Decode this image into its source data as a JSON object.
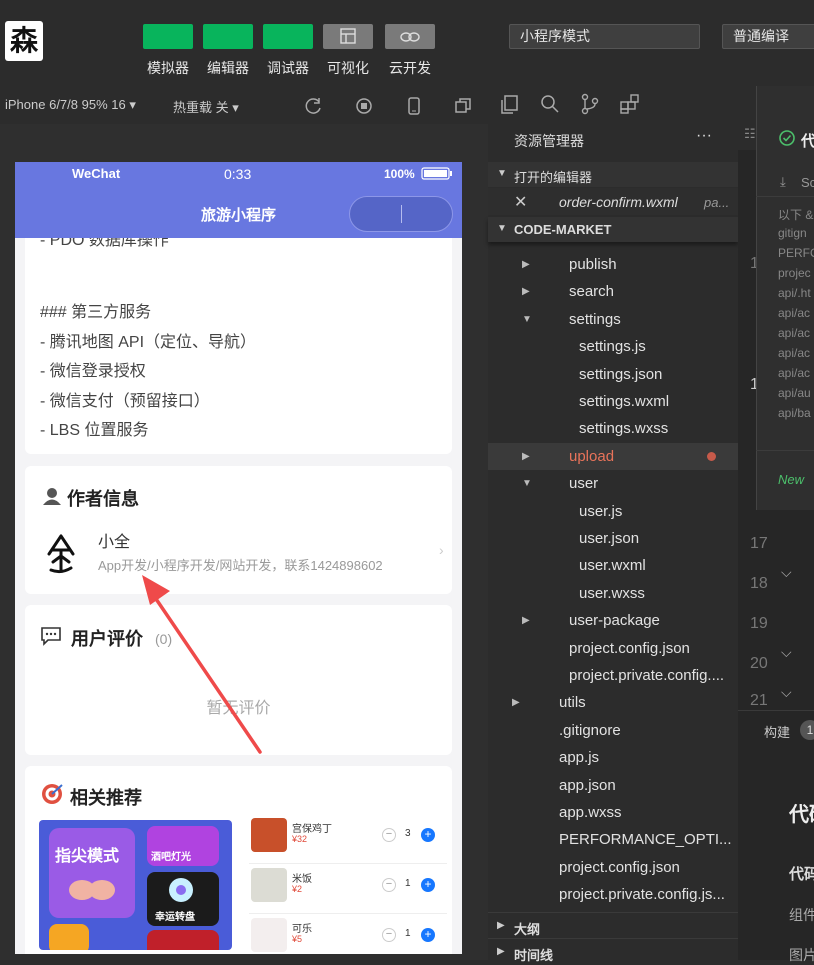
{
  "toolbar": {
    "logo": "森",
    "buttons": [
      {
        "label": "模拟器"
      },
      {
        "label": "编辑器"
      },
      {
        "label": "调试器"
      },
      {
        "label": "可视化"
      },
      {
        "label": "云开发"
      }
    ],
    "mode_select": "小程序模式",
    "compile_select": "普通编译"
  },
  "simulator_bar": {
    "device": "iPhone 6/7/8 95% 16 ▾",
    "hot_reload": "热重载 关 ▾"
  },
  "phone": {
    "status": {
      "carrier": "WeChat",
      "time": "0:33",
      "battery": "100%"
    },
    "nav_title": "旅游小程序",
    "readme_top": "- PDO 数据库操作",
    "readme_heading": "### 第三方服务",
    "readme_items": [
      "- 腾讯地图 API（定位、导航）",
      "- 微信登录授权",
      "- 微信支付（预留接口）",
      "- LBS 位置服务"
    ],
    "author_section": {
      "title": "作者信息",
      "name": "小全",
      "desc": "App开发/小程序开发/网站开发，联系1424898602"
    },
    "review_section": {
      "title": "用户评价",
      "count": "(0)",
      "empty": "暂无评价"
    },
    "recommend_section": {
      "title": "相关推荐",
      "tiles": [
        "指尖模式",
        "酒吧灯光",
        "幸运转盘"
      ],
      "foods": [
        {
          "name": "宫保鸡丁",
          "price": "¥32",
          "qty": "3"
        },
        {
          "name": "米饭",
          "price": "¥2",
          "qty": "1"
        },
        {
          "name": "可乐",
          "price": "¥5",
          "qty": "1"
        }
      ]
    }
  },
  "explorer": {
    "title": "资源管理器",
    "more": "···",
    "open_editors": "打开的编辑器",
    "open_file": "order-confirm.wxml",
    "open_file_path": "pa...",
    "root": "CODE-MARKET",
    "tree": [
      {
        "name": "publish",
        "indent": 1,
        "arrow": "right",
        "color": "#e2e2e2"
      },
      {
        "name": "search",
        "indent": 1,
        "arrow": "right",
        "color": "#e2e2e2"
      },
      {
        "name": "settings",
        "indent": 1,
        "arrow": "down",
        "color": "#e2e2e2"
      },
      {
        "name": "settings.js",
        "indent": 2,
        "arrow": "",
        "color": "#e2e2e2"
      },
      {
        "name": "settings.json",
        "indent": 2,
        "arrow": "",
        "color": "#e2e2e2"
      },
      {
        "name": "settings.wxml",
        "indent": 2,
        "arrow": "",
        "color": "#e2e2e2"
      },
      {
        "name": "settings.wxss",
        "indent": 2,
        "arrow": "",
        "color": "#e2e2e2"
      },
      {
        "name": "upload",
        "indent": 1,
        "arrow": "right",
        "color": "#e8735a"
      },
      {
        "name": "user",
        "indent": 1,
        "arrow": "down",
        "color": "#e2e2e2"
      },
      {
        "name": "user.js",
        "indent": 2,
        "arrow": "",
        "color": "#e2e2e2"
      },
      {
        "name": "user.json",
        "indent": 2,
        "arrow": "",
        "color": "#e2e2e2"
      },
      {
        "name": "user.wxml",
        "indent": 2,
        "arrow": "",
        "color": "#e2e2e2"
      },
      {
        "name": "user.wxss",
        "indent": 2,
        "arrow": "",
        "color": "#e2e2e2"
      },
      {
        "name": "user-package",
        "indent": 1,
        "arrow": "right",
        "color": "#e2e2e2"
      },
      {
        "name": "project.config.json",
        "indent": 1,
        "arrow": "",
        "color": "#e2e2e2"
      },
      {
        "name": "project.private.config....",
        "indent": 1,
        "arrow": "",
        "color": "#e2e2e2"
      },
      {
        "name": "utils",
        "indent": 0,
        "arrow": "right",
        "color": "#e2e2e2"
      },
      {
        "name": ".gitignore",
        "indent": 0,
        "arrow": "",
        "color": "#e2e2e2"
      },
      {
        "name": "app.js",
        "indent": 0,
        "arrow": "",
        "color": "#e2e2e2"
      },
      {
        "name": "app.json",
        "indent": 0,
        "arrow": "",
        "color": "#e2e2e2"
      },
      {
        "name": "app.wxss",
        "indent": 0,
        "arrow": "",
        "color": "#e2e2e2"
      },
      {
        "name": "PERFORMANCE_OPTI...",
        "indent": 0,
        "arrow": "",
        "color": "#e2e2e2"
      },
      {
        "name": "project.config.json",
        "indent": 0,
        "arrow": "",
        "color": "#e2e2e2"
      },
      {
        "name": "project.private.config.js...",
        "indent": 0,
        "arrow": "",
        "color": "#e2e2e2"
      }
    ],
    "outline": "大纲",
    "timeline": "时间线"
  },
  "editor": {
    "popup_title": "代",
    "popup_sub": "Sc",
    "popup_lines": [
      "以下 &",
      "gitign",
      "PERFO",
      "projec",
      "api/.ht",
      "api/ac",
      "api/ac",
      "api/ac",
      "api/ac",
      "api/au",
      "api/ba"
    ],
    "popup_new": "New",
    "gutter": [
      "1",
      "1",
      "17",
      "18",
      "19",
      "20",
      "21"
    ],
    "build": "构建",
    "build_badge": "1",
    "doc_heading": "代码",
    "doc_sub": "代码",
    "doc_line1": "组件",
    "doc_line2": "图片"
  }
}
